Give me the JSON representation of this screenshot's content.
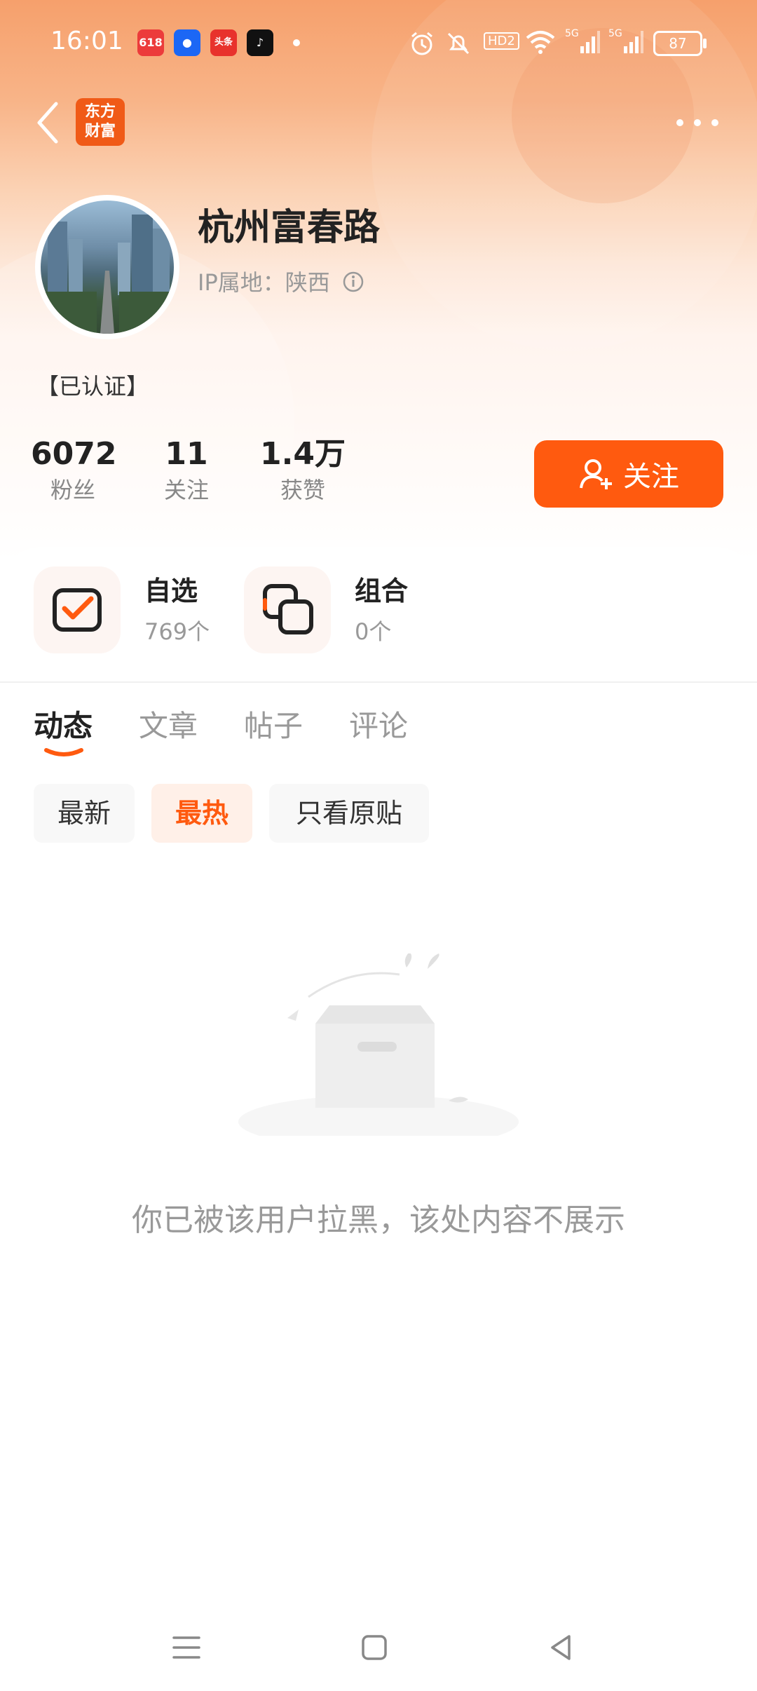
{
  "status_bar": {
    "time": "16:01",
    "app_badges": [
      "618",
      "●",
      "头条",
      "♪"
    ],
    "battery": "87",
    "network": "5G"
  },
  "nav": {
    "logo_line1": "东方",
    "logo_line2": "财富"
  },
  "profile": {
    "name": "杭州富春路",
    "ip_location": "IP属地：陕西",
    "verified": "【已认证】"
  },
  "stats": [
    {
      "value": "6072",
      "label": "粉丝"
    },
    {
      "value": "11",
      "label": "关注"
    },
    {
      "value": "1.4万",
      "label": "获赞"
    }
  ],
  "follow_button": "关注",
  "cards": [
    {
      "title": "自选",
      "sub": "769个"
    },
    {
      "title": "组合",
      "sub": "0个"
    }
  ],
  "tabs": [
    "动态",
    "文章",
    "帖子",
    "评论"
  ],
  "filters": [
    "最新",
    "最热",
    "只看原贴"
  ],
  "empty_message": "你已被该用户拉黑，该处内容不展示",
  "colors": {
    "accent": "#ff5a0f",
    "logo": "#f05a17"
  }
}
